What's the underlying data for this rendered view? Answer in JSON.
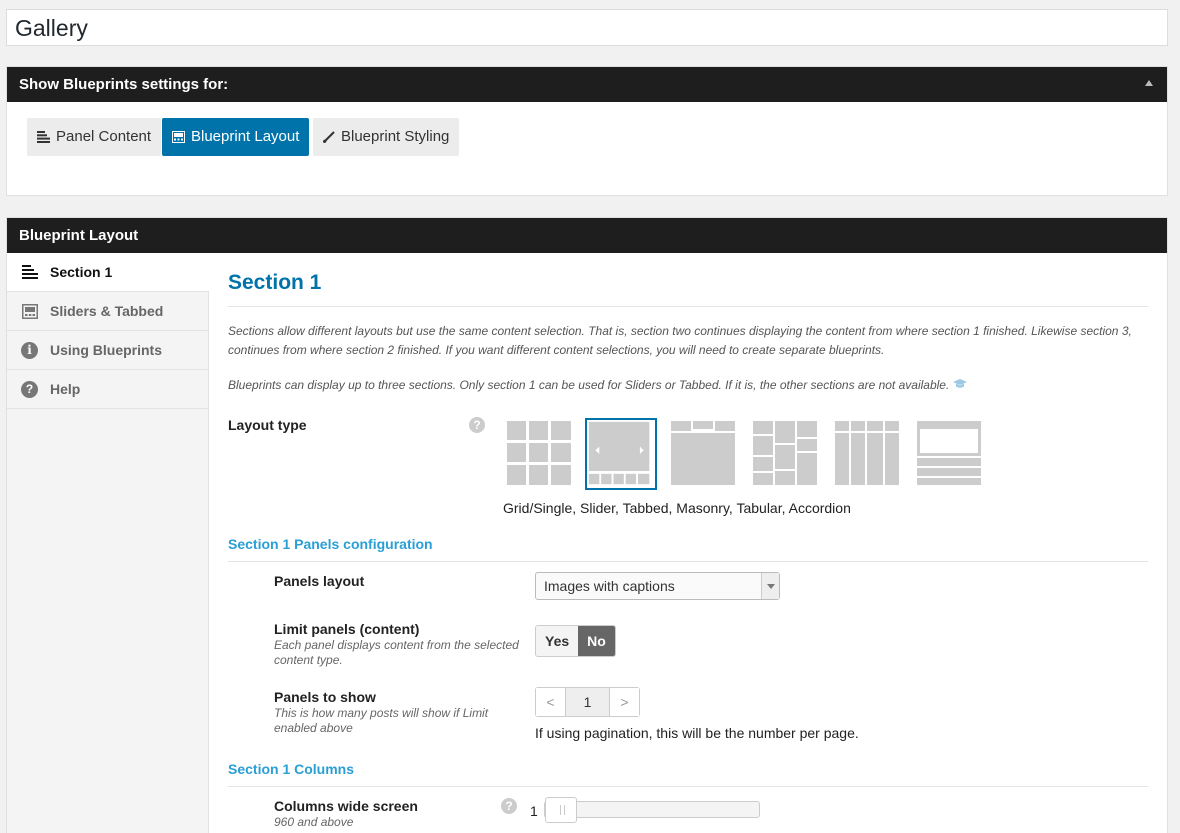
{
  "page_title": "Gallery",
  "show_panel": {
    "header": "Show Blueprints settings for:",
    "tabs": [
      {
        "label": "Panel Content",
        "icon": "list-icon"
      },
      {
        "label": "Blueprint Layout",
        "icon": "layout-icon",
        "active": true
      },
      {
        "label": "Blueprint Styling",
        "icon": "brush-icon"
      }
    ]
  },
  "layout_panel": {
    "header": "Blueprint Layout",
    "sidebar": [
      {
        "label": "Section 1",
        "icon": "list-icon",
        "active": true
      },
      {
        "label": "Sliders & Tabbed",
        "icon": "slider-icon"
      },
      {
        "label": "Using Blueprints",
        "icon": "info-icon"
      },
      {
        "label": "Help",
        "icon": "help-icon"
      }
    ]
  },
  "section": {
    "title": "Section 1",
    "note1": "Sections allow different layouts but use the same content selection. That is, section two continues displaying the content from where section 1 finished. Likewise section 3, continues from where section 2 finished. If you want different content selections, you will need to create separate blueprints.",
    "note2": "Blueprints can display up to three sections. Only section 1 can be used for Sliders or Tabbed. If it is, the other sections are not available.",
    "layout_type_label": "Layout type",
    "layout_caption": "Grid/Single, Slider, Tabbed, Masonry, Tabular, Accordion",
    "selected_layout": "Slider",
    "panels_config_title": "Section 1 Panels configuration",
    "panels_layout_label": "Panels layout",
    "panels_layout_value": "Images with captions",
    "limit_label": "Limit panels (content)",
    "limit_desc": "Each panel displays content from the selected content type.",
    "limit_yes": "Yes",
    "limit_no": "No",
    "limit_value": "No",
    "panels_show_label": "Panels to show",
    "panels_show_desc": "This is how many posts will show if Limit enabled above",
    "panels_show_value": "1",
    "panels_show_prev": "<",
    "panels_show_next": ">",
    "pagination_note": "If using pagination, this will be the number per page.",
    "columns_title": "Section 1 Columns",
    "columns_wide_label": "Columns wide screen",
    "columns_wide_desc": "960 and above",
    "columns_wide_value": "1",
    "help_glyph": "?"
  },
  "colors": {
    "accent": "#0073aa",
    "header_bg": "#1e1e1e",
    "subheading": "#2a9fd6"
  }
}
